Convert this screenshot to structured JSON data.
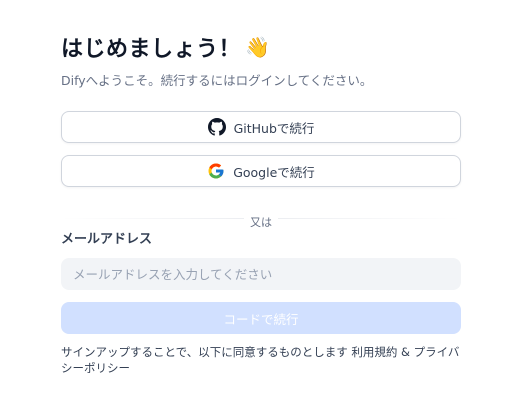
{
  "header": {
    "title": "はじめましょう！",
    "wave_emoji": "👋",
    "subtitle": "Difyへようこそ。続行するにはログインしてください。"
  },
  "oauth": {
    "github_label": "GitHubで続行",
    "google_label": "Googleで続行"
  },
  "divider": {
    "text": "又は"
  },
  "email": {
    "label": "メールアドレス",
    "placeholder": "メールアドレスを入力してください",
    "value": ""
  },
  "submit": {
    "label": "コードで続行"
  },
  "terms": {
    "prefix": "サインアップすることで、以下に同意するものとします ",
    "terms_link": "利用規約",
    "and": " & ",
    "privacy_link": "プライバシーポリシー"
  },
  "colors": {
    "primary_disabled": "#d1e0ff",
    "input_bg": "#f2f4f7",
    "border": "#d0d5dd"
  },
  "icons": {
    "github": "github-icon",
    "google": "google-icon"
  }
}
